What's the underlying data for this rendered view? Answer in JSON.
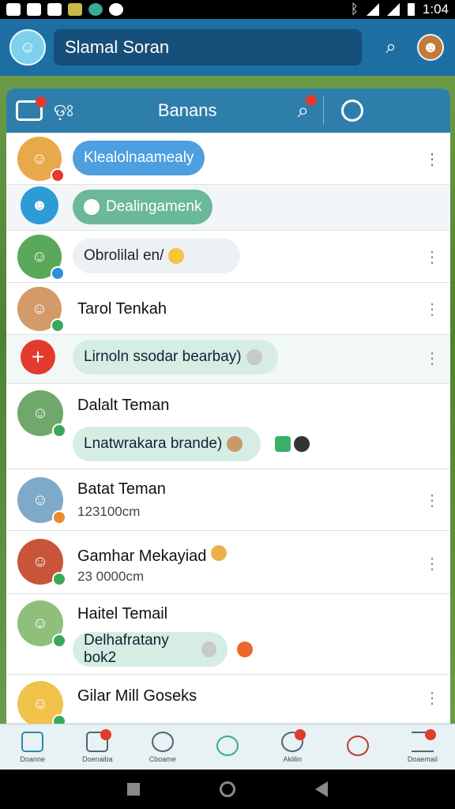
{
  "status_bar": {
    "time": "1:04"
  },
  "app_bar": {
    "search_text": "Slamal Soran"
  },
  "panel": {
    "glyphs": "ଡ଼ଃ",
    "title": "Banans"
  },
  "chats": [
    {
      "bubble": "Klealolnaamealy",
      "style": "blue"
    },
    {
      "bubble": "Dealingamenk",
      "style": "green"
    },
    {
      "bubble": "Obrolilal en/",
      "style": "grey"
    },
    {
      "name": "Tarol Tenkah"
    },
    {
      "bubble": "Lirnoln ssodar bearbay)",
      "style": "mint"
    },
    {
      "name": "Dalalt Teman",
      "bubble": "Lnatwrakara brande)"
    },
    {
      "name": "Batat Teman",
      "sub": "123100cm"
    },
    {
      "name": "Gamhar Mekayiad",
      "sub": "23 0000cm"
    },
    {
      "name": "Haitel Temail",
      "bubble": "Delhafratany bok2"
    },
    {
      "name": "Gilar Mill Goseks"
    }
  ],
  "nav": [
    {
      "label": "Doanne"
    },
    {
      "label": "Doenaiba"
    },
    {
      "label": "Cboame"
    },
    {
      "label": ""
    },
    {
      "label": "Aklilin"
    },
    {
      "label": ""
    },
    {
      "label": "Doaemail"
    }
  ],
  "colors": {
    "primary": "#1d6fa3",
    "panel_head": "#2e7eac",
    "accent_red": "#e23b2e"
  }
}
